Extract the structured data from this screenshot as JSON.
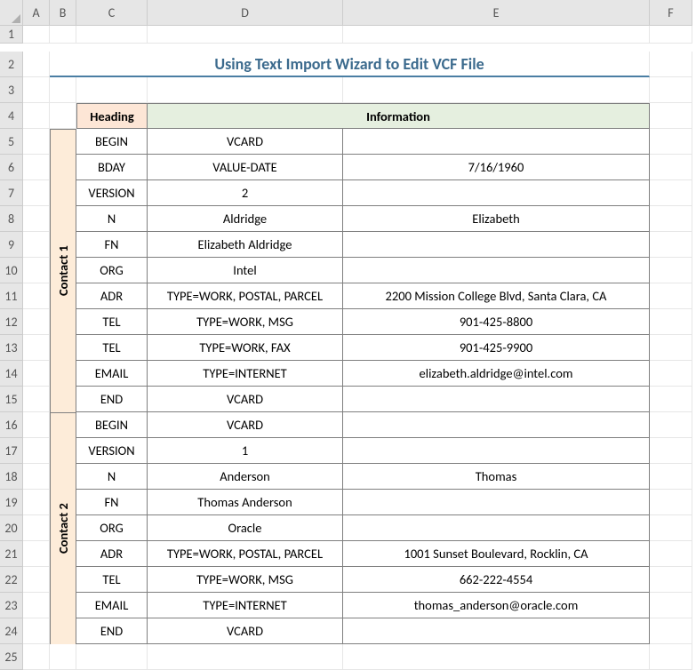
{
  "columns": [
    "A",
    "B",
    "C",
    "D",
    "E",
    "F"
  ],
  "rows": [
    "1",
    "2",
    "3",
    "4",
    "5",
    "6",
    "7",
    "8",
    "9",
    "10",
    "11",
    "12",
    "13",
    "14",
    "15",
    "16",
    "17",
    "18",
    "19",
    "20",
    "21",
    "22",
    "23",
    "24",
    "25"
  ],
  "title": "Using Text Import Wizard to Edit VCF File",
  "headers": {
    "heading": "Heading",
    "information": "Information"
  },
  "contacts": [
    {
      "label": "Contact 1",
      "rows": [
        {
          "heading": "BEGIN",
          "c1": "VCARD",
          "c2": ""
        },
        {
          "heading": "BDAY",
          "c1": "VALUE-DATE",
          "c2": "7/16/1960"
        },
        {
          "heading": "VERSION",
          "c1": "2",
          "c2": ""
        },
        {
          "heading": "N",
          "c1": "Aldridge",
          "c2": "Elizabeth"
        },
        {
          "heading": "FN",
          "c1": "Elizabeth Aldridge",
          "c2": ""
        },
        {
          "heading": "ORG",
          "c1": "Intel",
          "c2": ""
        },
        {
          "heading": "ADR",
          "c1": "TYPE=WORK, POSTAL, PARCEL",
          "c2": "2200 Mission College Blvd, Santa Clara, CA"
        },
        {
          "heading": "TEL",
          "c1": "TYPE=WORK, MSG",
          "c2": "901-425-8800"
        },
        {
          "heading": "TEL",
          "c1": "TYPE=WORK, FAX",
          "c2": "901-425-9900"
        },
        {
          "heading": "EMAIL",
          "c1": "TYPE=INTERNET",
          "c2": "elizabeth.aldridge@intel.com"
        },
        {
          "heading": "END",
          "c1": "VCARD",
          "c2": ""
        }
      ]
    },
    {
      "label": "Contact 2",
      "rows": [
        {
          "heading": "BEGIN",
          "c1": "VCARD",
          "c2": ""
        },
        {
          "heading": "VERSION",
          "c1": "1",
          "c2": ""
        },
        {
          "heading": "N",
          "c1": "Anderson",
          "c2": "Thomas"
        },
        {
          "heading": "FN",
          "c1": "Thomas Anderson",
          "c2": ""
        },
        {
          "heading": "ORG",
          "c1": "Oracle",
          "c2": ""
        },
        {
          "heading": "ADR",
          "c1": "TYPE=WORK, POSTAL, PARCEL",
          "c2": "1001 Sunset Boulevard, Rocklin, CA"
        },
        {
          "heading": "TEL",
          "c1": "TYPE=WORK, MSG",
          "c2": "662-222-4554"
        },
        {
          "heading": "EMAIL",
          "c1": "TYPE=INTERNET",
          "c2": "thomas_anderson@oracle.com"
        },
        {
          "heading": "END",
          "c1": "VCARD",
          "c2": ""
        }
      ]
    }
  ]
}
